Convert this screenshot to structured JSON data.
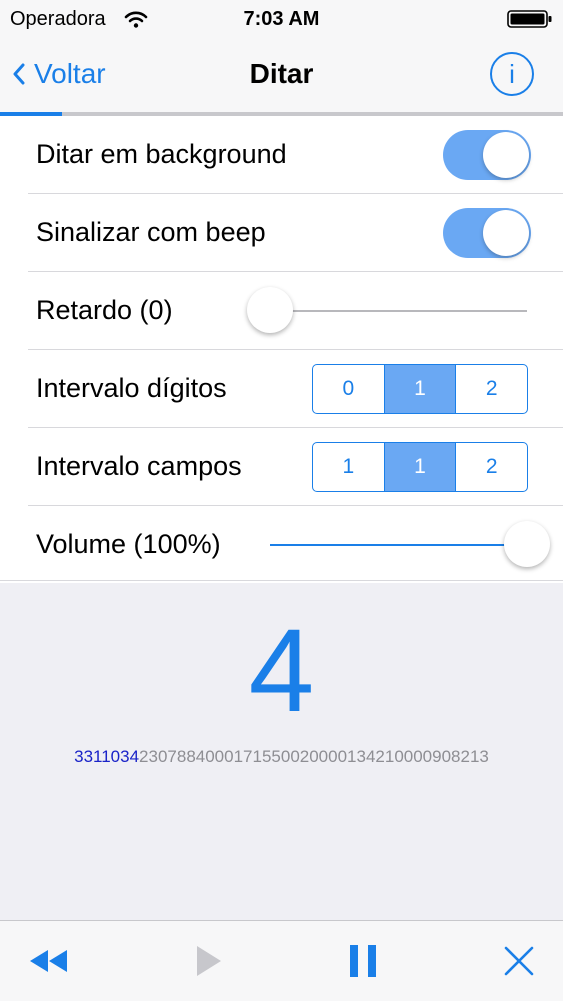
{
  "status_bar": {
    "carrier": "Operadora",
    "time": "7:03 AM",
    "wifi_icon": "wifi-icon",
    "battery_icon": "battery-full-icon",
    "battery_level": 1.0
  },
  "nav": {
    "back_label": "Voltar",
    "title": "Ditar",
    "info_label": "i",
    "progress": 0.11
  },
  "settings": {
    "background": {
      "label": "Ditar em background",
      "on": true
    },
    "beep": {
      "label": "Sinalizar com beep",
      "on": true
    },
    "delay": {
      "label": "Retardo (0)",
      "value": 0.0
    },
    "digit_interval": {
      "label": "Intervalo dígitos",
      "options": [
        "0",
        "1",
        "2"
      ],
      "selected_index": 1
    },
    "field_interval": {
      "label": "Intervalo campos",
      "options": [
        "1",
        "1",
        "2"
      ],
      "selected_index": 1
    },
    "volume": {
      "label": "Volume (100%)",
      "value": 1.0
    }
  },
  "dictation": {
    "current_digit": "4",
    "sequence_done": "3311034",
    "sequence_pending": "2307884000171550020000134210000908213"
  },
  "toolbar": {
    "rewind_icon": "rewind-icon",
    "play_icon": "play-icon",
    "pause_icon": "pause-icon",
    "close_icon": "close-icon"
  },
  "colors": {
    "accent": "#1a7fe8",
    "toggle_on": "#6aa8f3",
    "sequence_done": "#1a23c8",
    "sequence_pending": "#8e8e93",
    "disabled": "#c7c7cc"
  }
}
